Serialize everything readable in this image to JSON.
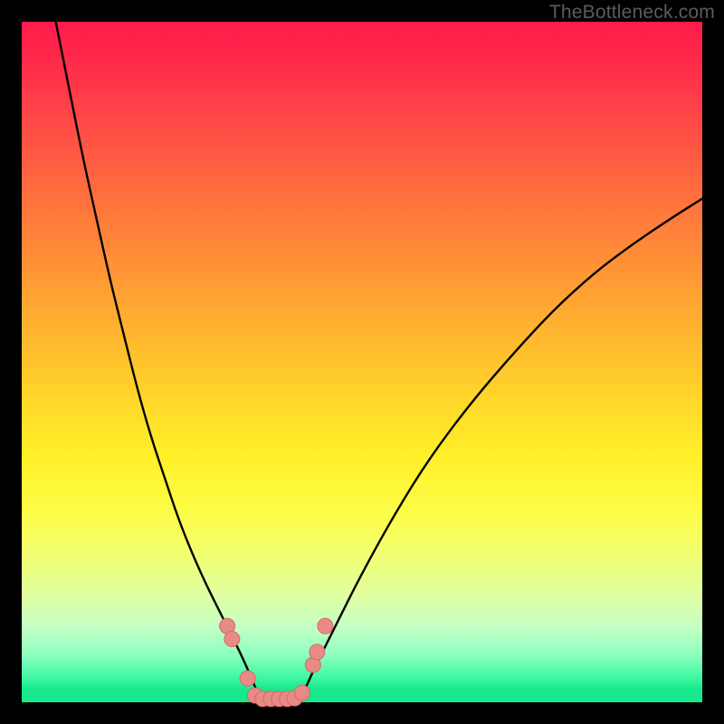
{
  "watermark": "TheBottleneck.com",
  "colors": {
    "frame": "#000000",
    "curve": "#000000",
    "marker_fill": "#e88a86",
    "marker_stroke": "#d46d68",
    "gradient_top": "#ff1a4b",
    "gradient_bottom": "#16e88b"
  },
  "chart_data": {
    "type": "line",
    "title": "",
    "xlabel": "",
    "ylabel": "",
    "xlim": [
      0,
      100
    ],
    "ylim": [
      0,
      100
    ],
    "grid": false,
    "legend": false,
    "note": "Axes have no tick labels in the source image; x/y values are normalized 0–100 estimates read from pixel positions. y is the bottleneck-percentage-like quantity (0 at bottom green band, 100 at top red).",
    "series": [
      {
        "name": "left-branch",
        "x": [
          5,
          7,
          9,
          11,
          13,
          15,
          17,
          19,
          21,
          23,
          25,
          27,
          29,
          30.5,
          32,
          33.5,
          35
        ],
        "y": [
          100,
          90,
          80,
          71,
          62,
          54,
          46,
          39,
          33,
          27,
          22,
          17.5,
          13.5,
          10.5,
          7.5,
          4.2,
          0.5
        ]
      },
      {
        "name": "right-branch",
        "x": [
          41,
          43,
          46,
          50,
          55,
          60,
          66,
          72,
          78,
          84,
          90,
          96,
          100
        ],
        "y": [
          0.5,
          5,
          11,
          19,
          28,
          36,
          44,
          51,
          57.5,
          63,
          67.5,
          71.5,
          74
        ]
      },
      {
        "name": "markers",
        "note": "Salmon points along the valley; plateau between the two branches.",
        "points": [
          {
            "x": 30.2,
            "y": 11.2
          },
          {
            "x": 30.9,
            "y": 9.3
          },
          {
            "x": 33.2,
            "y": 3.5
          },
          {
            "x": 34.3,
            "y": 1.0
          },
          {
            "x": 35.4,
            "y": 0.5
          },
          {
            "x": 36.6,
            "y": 0.5
          },
          {
            "x": 37.8,
            "y": 0.5
          },
          {
            "x": 39.0,
            "y": 0.5
          },
          {
            "x": 40.1,
            "y": 0.6
          },
          {
            "x": 41.2,
            "y": 1.4
          },
          {
            "x": 42.8,
            "y": 5.5
          },
          {
            "x": 43.4,
            "y": 7.4
          },
          {
            "x": 44.6,
            "y": 11.2
          }
        ]
      }
    ]
  }
}
